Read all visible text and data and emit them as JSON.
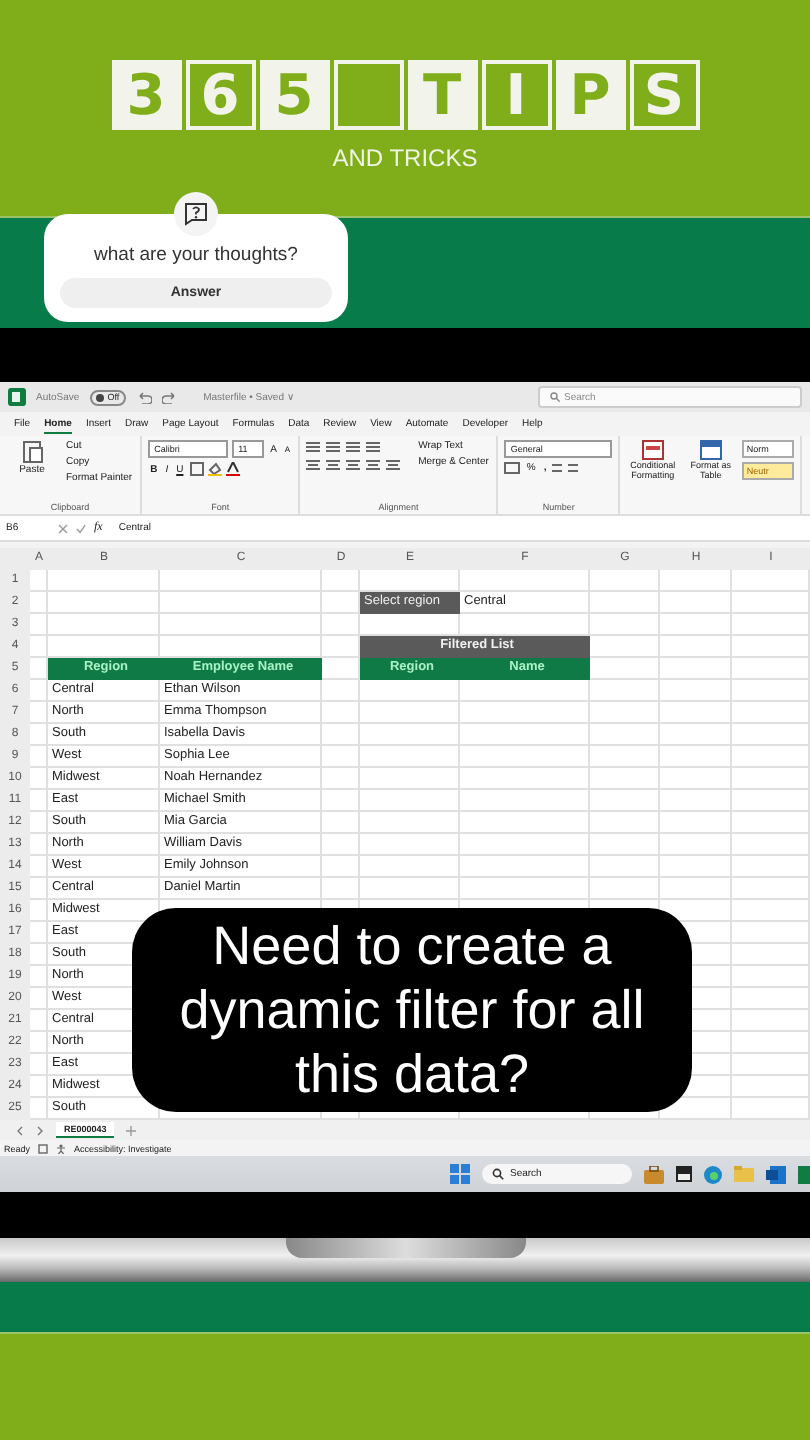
{
  "logo": {
    "tiles": [
      {
        "kind": "letter",
        "text": "3"
      },
      {
        "kind": "letter",
        "text": "6"
      },
      {
        "kind": "letter",
        "text": "5"
      },
      {
        "kind": "blank"
      },
      {
        "kind": "letter",
        "text": "T"
      },
      {
        "kind": "letter",
        "text": "I"
      },
      {
        "kind": "letter",
        "text": "P"
      },
      {
        "kind": "letter",
        "text": "S"
      }
    ],
    "subtitle": "AND TRICKS"
  },
  "question_sticker": {
    "prompt": "what are your thoughts?",
    "button": "Answer"
  },
  "excel": {
    "title_bar": {
      "autosave_label": "AutoSave",
      "autosave": {
        "label": "Off",
        "on": false
      },
      "file_title": "Masterfile • Saved ∨",
      "search_placeholder": "Search"
    },
    "menu_tabs": [
      {
        "label": "File",
        "selected": false
      },
      {
        "label": "Home",
        "selected": true
      },
      {
        "label": "Insert",
        "selected": false
      },
      {
        "label": "Draw",
        "selected": false
      },
      {
        "label": "Page Layout",
        "selected": false
      },
      {
        "label": "Formulas",
        "selected": false
      },
      {
        "label": "Data",
        "selected": false
      },
      {
        "label": "Review",
        "selected": false
      },
      {
        "label": "View",
        "selected": false
      },
      {
        "label": "Automate",
        "selected": false
      },
      {
        "label": "Developer",
        "selected": false
      },
      {
        "label": "Help",
        "selected": false
      }
    ],
    "ribbon_groups": [
      {
        "kind": "clipboard",
        "label": "Clipboard",
        "items": [
          "Paste",
          "Cut",
          "Copy",
          "Format Painter"
        ]
      },
      {
        "kind": "font",
        "label": "Font",
        "items": [
          "Calibri",
          "11",
          "A",
          "A",
          "B",
          "I",
          "U"
        ]
      },
      {
        "kind": "alignment",
        "label": "Alignment",
        "items": [
          "Wrap Text",
          "Merge & Center"
        ]
      },
      {
        "kind": "number",
        "label": "Number",
        "items": [
          "General",
          "%",
          ","
        ]
      },
      {
        "kind": "styles",
        "items": [
          "Conditional Formatting",
          "Format as Table",
          "Norm",
          "Neutr"
        ]
      }
    ],
    "formula_bar": {
      "name_box": "B6",
      "fx": "fx",
      "value": "Central"
    },
    "columns": [
      "A",
      "B",
      "C",
      "D",
      "E",
      "F",
      "G",
      "H",
      "I"
    ],
    "row_numbers": [
      "1",
      "2",
      "3",
      "4",
      "5",
      "6",
      "7",
      "8",
      "9",
      "10",
      "11",
      "12",
      "13",
      "14",
      "15",
      "16",
      "17",
      "18",
      "19",
      "20",
      "21",
      "22",
      "23",
      "24",
      "25"
    ],
    "select_label": "Select region",
    "select_value": "Central",
    "filtered_title": "Filtered List",
    "filtered_headers": [
      "Region",
      "Name"
    ],
    "headers": [
      "Region",
      "Employee Name"
    ],
    "rows": [
      {
        "region": "Central",
        "name": "Ethan Wilson"
      },
      {
        "region": "North",
        "name": "Emma Thompson"
      },
      {
        "region": "South",
        "name": "Isabella Davis"
      },
      {
        "region": "West",
        "name": "Sophia Lee"
      },
      {
        "region": "Midwest",
        "name": "Noah Hernandez"
      },
      {
        "region": "East",
        "name": "Michael Smith"
      },
      {
        "region": "South",
        "name": "Mia Garcia"
      },
      {
        "region": "North",
        "name": "William Davis"
      },
      {
        "region": "West",
        "name": "Emily Johnson"
      },
      {
        "region": "Central",
        "name": "Daniel Martin"
      },
      {
        "region": "Midwest"
      },
      {
        "region": "East"
      },
      {
        "region": "South"
      },
      {
        "region": "North"
      },
      {
        "region": "West"
      },
      {
        "region": "Central"
      },
      {
        "region": "North"
      },
      {
        "region": "East"
      },
      {
        "region": "Midwest"
      },
      {
        "region": "South"
      }
    ],
    "sheet_tabs": [
      {
        "label": "RE000043",
        "selected": true
      }
    ],
    "status": {
      "ready": "Ready",
      "accessibility": "Accessibility: Investigate"
    },
    "taskbar": {
      "search_placeholder": "Search"
    }
  },
  "caption": "Need to create a dynamic filter for all this data?"
}
